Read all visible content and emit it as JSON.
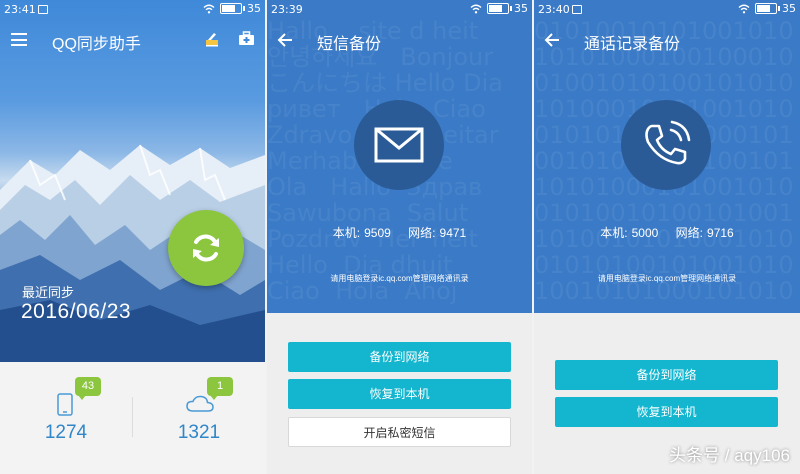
{
  "screens": [
    {
      "status": {
        "time": "23:41",
        "battery": "35"
      },
      "title": "QQ同步助手",
      "last_sync_label": "最近同步",
      "last_sync_date": "2016/06/23",
      "stats": [
        {
          "icon": "phone-icon",
          "badge": "43",
          "count": "1274"
        },
        {
          "icon": "cloud-icon",
          "badge": "1",
          "count": "1321"
        }
      ]
    },
    {
      "status": {
        "time": "23:39",
        "battery": "35"
      },
      "title": "短信备份",
      "icon": "envelope-icon",
      "local_label": "本机:",
      "local_value": "9509",
      "network_label": "网络:",
      "network_value": "9471",
      "hint": "请用电脑登录ic.qq.com管理网络通讯录",
      "buttons": [
        "备份到网络",
        "恢复到本机",
        "开启私密短信"
      ]
    },
    {
      "status": {
        "time": "23:40",
        "battery": "35"
      },
      "title": "通话记录备份",
      "icon": "phone-handset-icon",
      "local_label": "本机:",
      "local_value": "5000",
      "network_label": "网络:",
      "network_value": "9716",
      "hint": "请用电脑登录ic.qq.com管理网络通讯录",
      "buttons": [
        "备份到网络",
        "恢复到本机"
      ]
    }
  ],
  "watermark": "头条号 / aqy106",
  "colors": {
    "accent_cyan": "#14b6cf",
    "sync_green": "#8bc63e",
    "blue_bg": "#3a7ac6",
    "count_blue": "#2f86c8"
  }
}
